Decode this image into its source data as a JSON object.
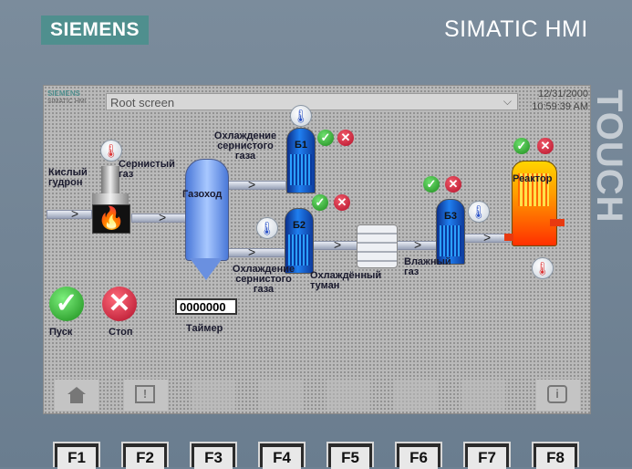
{
  "bezel": {
    "logo": "SIEMENS",
    "brand": "SIMATIC HMI",
    "touch": "TOUCH"
  },
  "topbar": {
    "mini_logo": "SIEMENS",
    "mini_sub": "SIMATIC HMI",
    "screen": "Root screen",
    "date": "12/31/2000",
    "time": "10:59:39 AM"
  },
  "labels": {
    "tar": "Кислый гудрон",
    "so2": "Сернистый газ",
    "duct": "Газоход",
    "cool1": "Охлаждение сернистого газа",
    "cool2": "Охлаждение сернистого газа",
    "mist": "Охлаждённый туман",
    "wet": "Влажный газ",
    "reactor": "Реактор",
    "start": "Пуск",
    "stop": "Стоп",
    "timer": "Таймер"
  },
  "coolers": [
    {
      "name": "Б1"
    },
    {
      "name": "Б2"
    },
    {
      "name": "Б3"
    }
  ],
  "timer_value": "0000000",
  "fkeys": [
    "F1",
    "F2",
    "F3",
    "F4",
    "F5",
    "F6",
    "F7",
    "F8"
  ],
  "icons": {
    "ok": "check-icon",
    "cancel": "cross-icon",
    "temp": "thermometer-icon",
    "home": "home-icon",
    "alarm": "warning-icon",
    "info": "info-icon"
  }
}
